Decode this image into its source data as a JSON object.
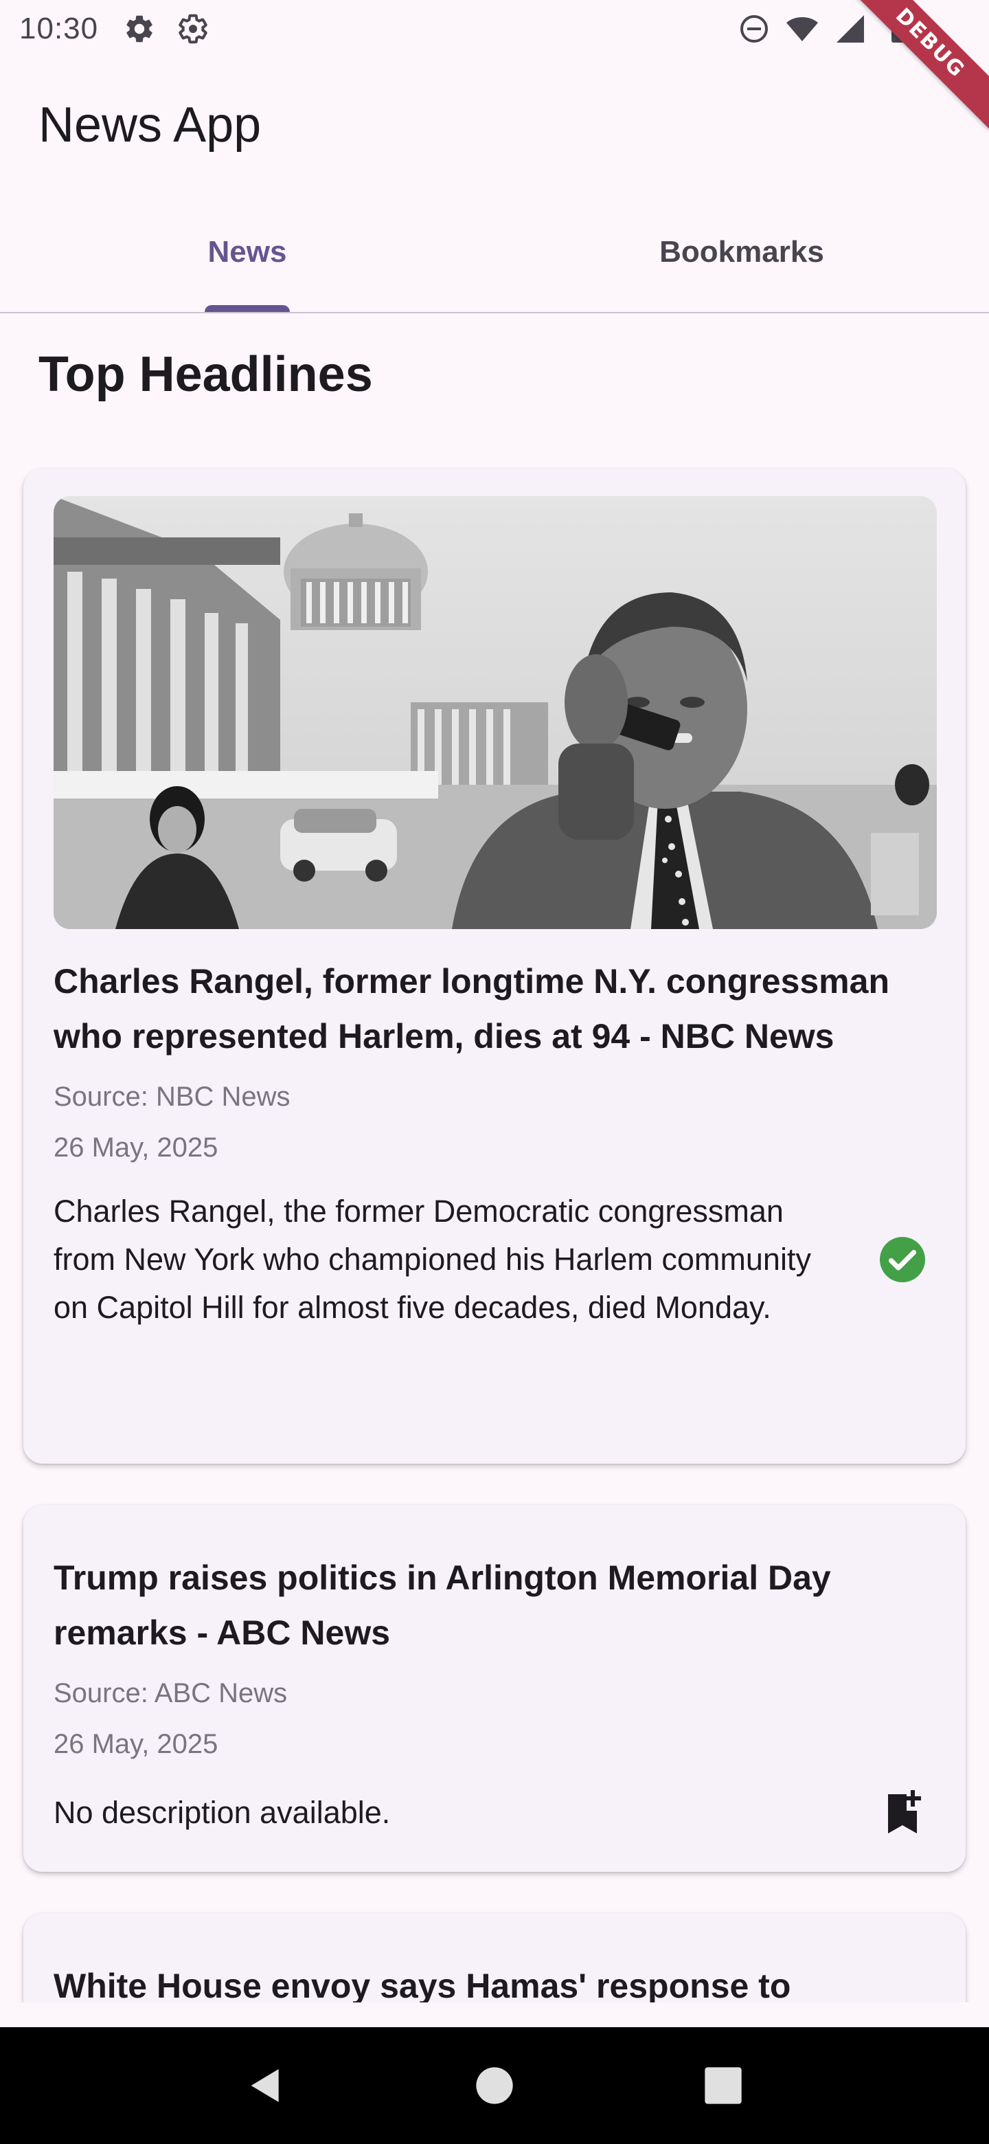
{
  "status_bar": {
    "time": "10:30",
    "icons": [
      "settings-icon",
      "settings-outline-icon",
      "do-not-disturb-icon",
      "wifi-icon",
      "signal-icon",
      "battery-icon"
    ],
    "debug_label": "DEBUG"
  },
  "app_bar": {
    "title": "News App"
  },
  "tabs": [
    {
      "label": "News",
      "active": true
    },
    {
      "label": "Bookmarks",
      "active": false
    }
  ],
  "section": {
    "title": "Top Headlines"
  },
  "articles": [
    {
      "has_image": true,
      "title": "Charles Rangel, former longtime N.Y. congressman who represented Harlem, dies at 94 - NBC News",
      "source": "Source: NBC News",
      "date": "26 May, 2025",
      "description": "Charles Rangel, the former Democratic congressman from New York who championed his Harlem community on Capitol Hill for almost five decades, died Monday.",
      "action_icon": "check-circle-icon",
      "bookmarked": true
    },
    {
      "has_image": false,
      "title": "Trump raises politics in Arlington Memorial Day remarks - ABC News",
      "source": "Source: ABC News",
      "date": "26 May, 2025",
      "description": "No description available.",
      "action_icon": "bookmark-add-icon",
      "bookmarked": false
    },
    {
      "has_image": false,
      "title": "White House envoy says Hamas' response to"
    }
  ],
  "colors": {
    "primary": "#65558f",
    "background": "#fdf7fc",
    "card": "#f7f2fa",
    "success": "#43a047",
    "debug_ribbon": "#b5364a"
  },
  "nav": {
    "icons": [
      "back-icon",
      "home-icon",
      "recents-icon"
    ]
  }
}
